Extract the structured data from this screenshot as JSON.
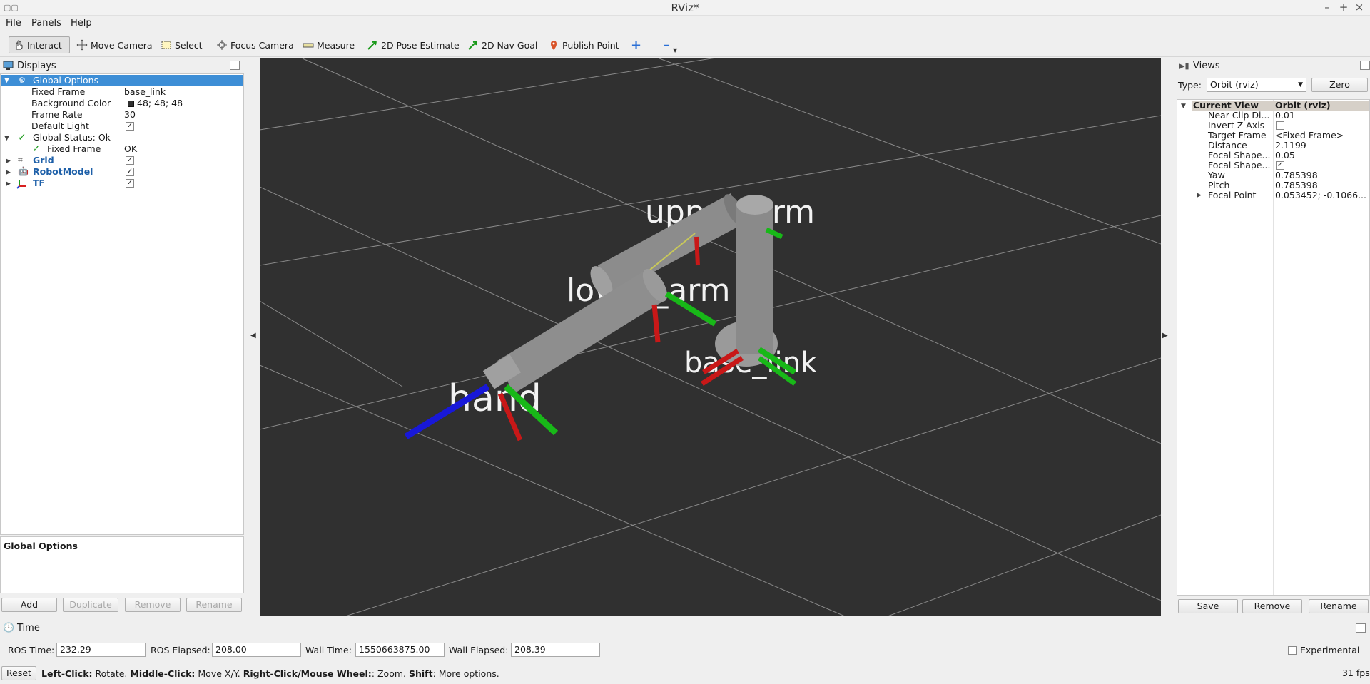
{
  "window": {
    "title": "RViz*",
    "icon": "rviz-app-icon",
    "controls": [
      "–",
      "+",
      "×"
    ]
  },
  "menubar": {
    "file": "File",
    "panels": "Panels",
    "help": "Help"
  },
  "toolbar": {
    "interact": "Interact",
    "move_camera": "Move Camera",
    "select": "Select",
    "focus_camera": "Focus Camera",
    "measure": "Measure",
    "pose_estimate": "2D Pose Estimate",
    "nav_goal": "2D Nav Goal",
    "publish_point": "Publish Point",
    "add_tool": "+",
    "remove_tool": "–"
  },
  "displays": {
    "title": "Displays",
    "global_options": {
      "label": "Global Options",
      "props": [
        {
          "name": "Fixed Frame",
          "value": "base_link"
        },
        {
          "name": "Background Color",
          "value": "48; 48; 48",
          "swatch": "#303030"
        },
        {
          "name": "Frame Rate",
          "value": "30"
        },
        {
          "name": "Default Light",
          "value": "✓"
        }
      ]
    },
    "global_status": {
      "label": "Global Status: Ok",
      "child_name": "Fixed Frame",
      "child_value": "OK"
    },
    "items": [
      {
        "label": "Grid",
        "checked": "✓"
      },
      {
        "label": "RobotModel",
        "checked": "✓"
      },
      {
        "label": "TF",
        "checked": "✓"
      }
    ],
    "description_title": "Global Options",
    "buttons": {
      "add": "Add",
      "duplicate": "Duplicate",
      "remove": "Remove",
      "rename": "Rename"
    }
  },
  "viewport": {
    "background": "#303030",
    "labels": {
      "upper_arm": "upper_arm",
      "lower_arm": "lower_arm",
      "base_link": "base_link",
      "hand": "hand"
    }
  },
  "views": {
    "title": "Views",
    "type_label": "Type:",
    "type_value": "Orbit (rviz)",
    "zero": "Zero",
    "header_name": "Current View",
    "header_value": "Orbit (rviz)",
    "props": [
      {
        "name": "Near Clip Di...",
        "value": "0.01"
      },
      {
        "name": "Invert Z Axis",
        "value": ""
      },
      {
        "name": "Target Frame",
        "value": "<Fixed Frame>"
      },
      {
        "name": "Distance",
        "value": "2.1199"
      },
      {
        "name": "Focal Shape...",
        "value": "0.05"
      },
      {
        "name": "Focal Shape...",
        "value": "✓"
      },
      {
        "name": "Yaw",
        "value": "0.785398"
      },
      {
        "name": "Pitch",
        "value": "0.785398"
      },
      {
        "name": "Focal Point",
        "value": "0.053452; -0.1066..."
      }
    ],
    "buttons": {
      "save": "Save",
      "remove": "Remove",
      "rename": "Rename"
    }
  },
  "time": {
    "title": "Time",
    "ros_time_label": "ROS Time:",
    "ros_time": "232.29",
    "ros_elapsed_label": "ROS Elapsed:",
    "ros_elapsed": "208.00",
    "wall_time_label": "Wall Time:",
    "wall_time": "1550663875.00",
    "wall_elapsed_label": "Wall Elapsed:",
    "wall_elapsed": "208.39",
    "experimental": "Experimental"
  },
  "statusbar": {
    "reset": "Reset",
    "left_click": "Left-Click:",
    "left_click_desc": " Rotate. ",
    "middle_click": "Middle-Click:",
    "middle_click_desc": " Move X/Y. ",
    "right_click": "Right-Click/Mouse Wheel:",
    "right_click_desc": ": Zoom. ",
    "shift": "Shift",
    "shift_desc": ": More options.",
    "fps": "31 fps"
  }
}
